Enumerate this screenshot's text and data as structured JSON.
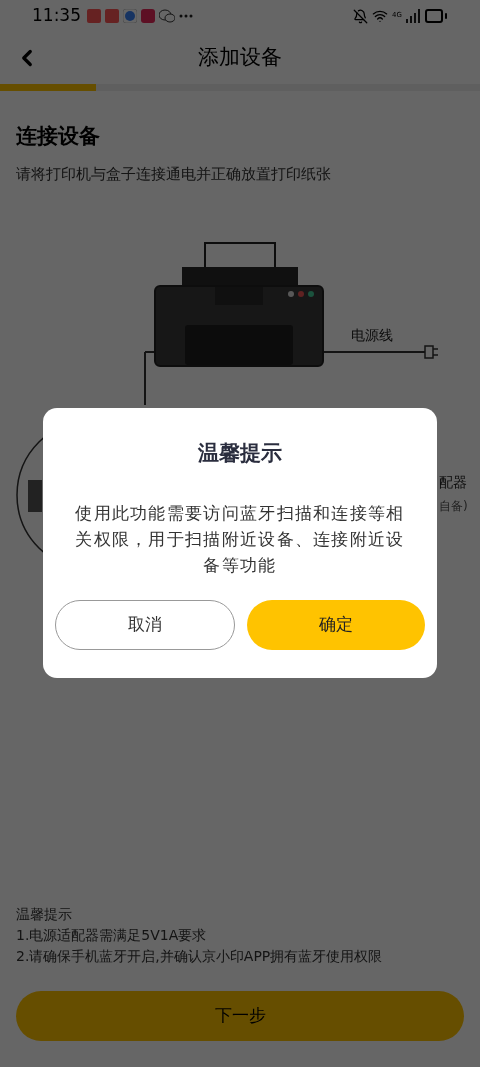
{
  "status_bar": {
    "time": "11:35",
    "network": "4G"
  },
  "header": {
    "title": "添加设备"
  },
  "progress": {
    "level": 0.2
  },
  "step": {
    "title": "连接设备",
    "subtitle": "请将打印机与盒子连接通电并正确放置打印纸张"
  },
  "diagram": {
    "labels": [
      {
        "kind": "cable",
        "text": "电源线"
      },
      {
        "kind": "adapter",
        "text": "配器"
      },
      {
        "kind": "note",
        "text": "自备)"
      }
    ]
  },
  "tips": {
    "title": "温馨提示",
    "items": [
      "1.电源适配器需满足5V1A要求",
      "2.请确保手机蓝牙开启,并确认京小印APP拥有蓝牙使用权限"
    ]
  },
  "next_button": {
    "label": "下一步"
  },
  "dialog": {
    "title": "温馨提示",
    "message": "使用此功能需要访问蓝牙扫描和连接等相关权限，用于扫描附近设备、连接附近设备等功能",
    "buttons": [
      {
        "label": "取消",
        "kind": "secondary"
      },
      {
        "label": "确定",
        "kind": "primary"
      }
    ]
  }
}
